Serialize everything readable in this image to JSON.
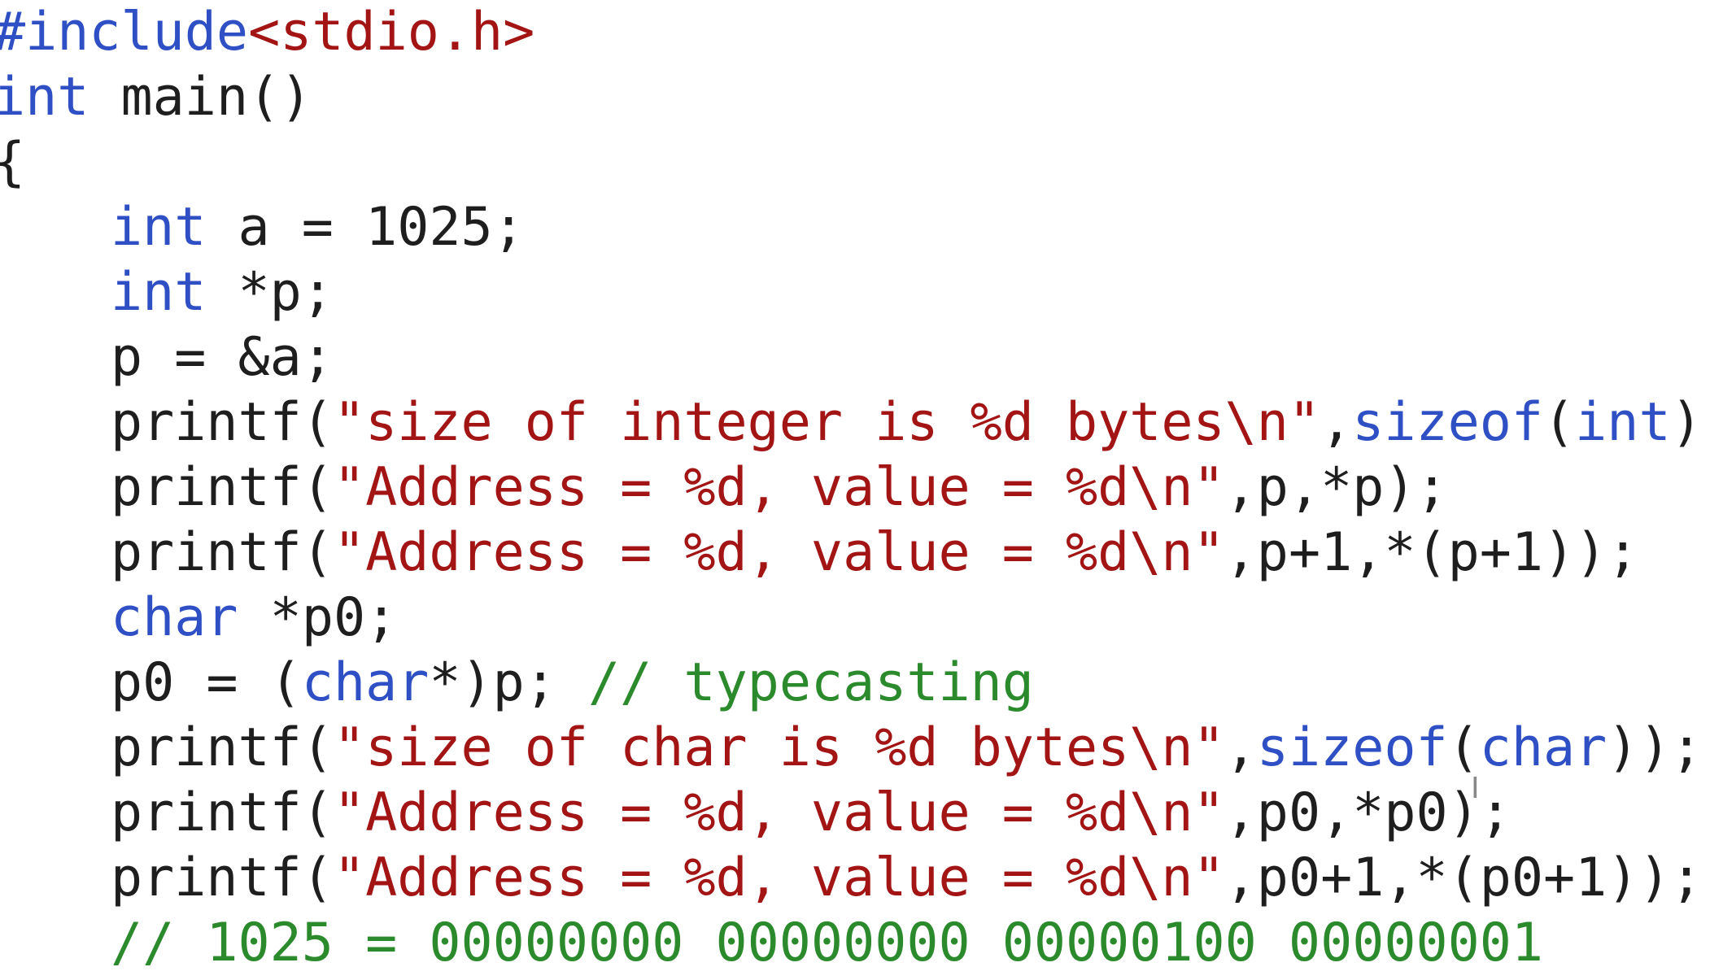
{
  "editor": {
    "lines": [
      [
        {
          "t": "#include",
          "k": "pp"
        },
        {
          "t": "<stdio.h>",
          "k": "str"
        }
      ],
      [
        {
          "t": "int",
          "k": "kw"
        },
        {
          "t": " main()",
          "k": "tx"
        }
      ],
      [
        {
          "t": "{",
          "k": "tx"
        }
      ],
      [
        {
          "t": "    ",
          "k": "ind"
        },
        {
          "t": "int",
          "k": "kw"
        },
        {
          "t": " a = 1025;",
          "k": "tx"
        }
      ],
      [
        {
          "t": "    ",
          "k": "ind"
        },
        {
          "t": "int",
          "k": "kw"
        },
        {
          "t": " *p;",
          "k": "tx"
        }
      ],
      [
        {
          "t": "    ",
          "k": "ind"
        },
        {
          "t": "p = &a;",
          "k": "tx"
        }
      ],
      [
        {
          "t": "    ",
          "k": "ind"
        },
        {
          "t": "printf(",
          "k": "tx"
        },
        {
          "t": "\"size of integer is %d bytes\\n\"",
          "k": "str"
        },
        {
          "t": ",",
          "k": "tx"
        },
        {
          "t": "sizeof",
          "k": "kw"
        },
        {
          "t": "(",
          "k": "tx"
        },
        {
          "t": "int",
          "k": "kw"
        },
        {
          "t": "));",
          "k": "tx"
        }
      ],
      [
        {
          "t": "    ",
          "k": "ind"
        },
        {
          "t": "printf(",
          "k": "tx"
        },
        {
          "t": "\"Address = %d, value = %d\\n\"",
          "k": "str"
        },
        {
          "t": ",p,*p);",
          "k": "tx"
        }
      ],
      [
        {
          "t": "    ",
          "k": "ind"
        },
        {
          "t": "printf(",
          "k": "tx"
        },
        {
          "t": "\"Address = %d, value = %d\\n\"",
          "k": "str"
        },
        {
          "t": ",p+1,*(p+1));",
          "k": "tx"
        }
      ],
      [
        {
          "t": "    ",
          "k": "ind"
        },
        {
          "t": "char",
          "k": "kw"
        },
        {
          "t": " *p0;",
          "k": "tx"
        }
      ],
      [
        {
          "t": "    ",
          "k": "ind"
        },
        {
          "t": "p0 = (",
          "k": "tx"
        },
        {
          "t": "char",
          "k": "kw"
        },
        {
          "t": "*)p; ",
          "k": "tx"
        },
        {
          "t": "// typecasting",
          "k": "cm"
        }
      ],
      [
        {
          "t": "    ",
          "k": "ind"
        },
        {
          "t": "printf(",
          "k": "tx"
        },
        {
          "t": "\"size of char is %d bytes\\n\"",
          "k": "str"
        },
        {
          "t": ",",
          "k": "tx"
        },
        {
          "t": "sizeof",
          "k": "kw"
        },
        {
          "t": "(",
          "k": "tx"
        },
        {
          "t": "char",
          "k": "kw"
        },
        {
          "t": "));",
          "k": "tx"
        }
      ],
      [
        {
          "t": "    ",
          "k": "ind"
        },
        {
          "t": "printf(",
          "k": "tx"
        },
        {
          "t": "\"Address = %d, value = %d\\n\"",
          "k": "str"
        },
        {
          "t": ",p0,*p0);",
          "k": "tx"
        }
      ],
      [
        {
          "t": "    ",
          "k": "ind"
        },
        {
          "t": "printf(",
          "k": "tx"
        },
        {
          "t": "\"Address = %d, value = %d\\n\"",
          "k": "str"
        },
        {
          "t": ",p0+1,*(p0+1));",
          "k": "tx"
        }
      ],
      [
        {
          "t": "    ",
          "k": "ind"
        },
        {
          "t": "// 1025 = 00000000 00000000 00000100 00000001",
          "k": "cm"
        }
      ]
    ]
  },
  "colors": {
    "keyword": "#2f4fc4",
    "string": "#a31515",
    "comment": "#2b8a2b",
    "text": "#1e1e1e",
    "background": "#ffffff"
  },
  "icons": {
    "cursor": "text-ibeam-cursor"
  }
}
